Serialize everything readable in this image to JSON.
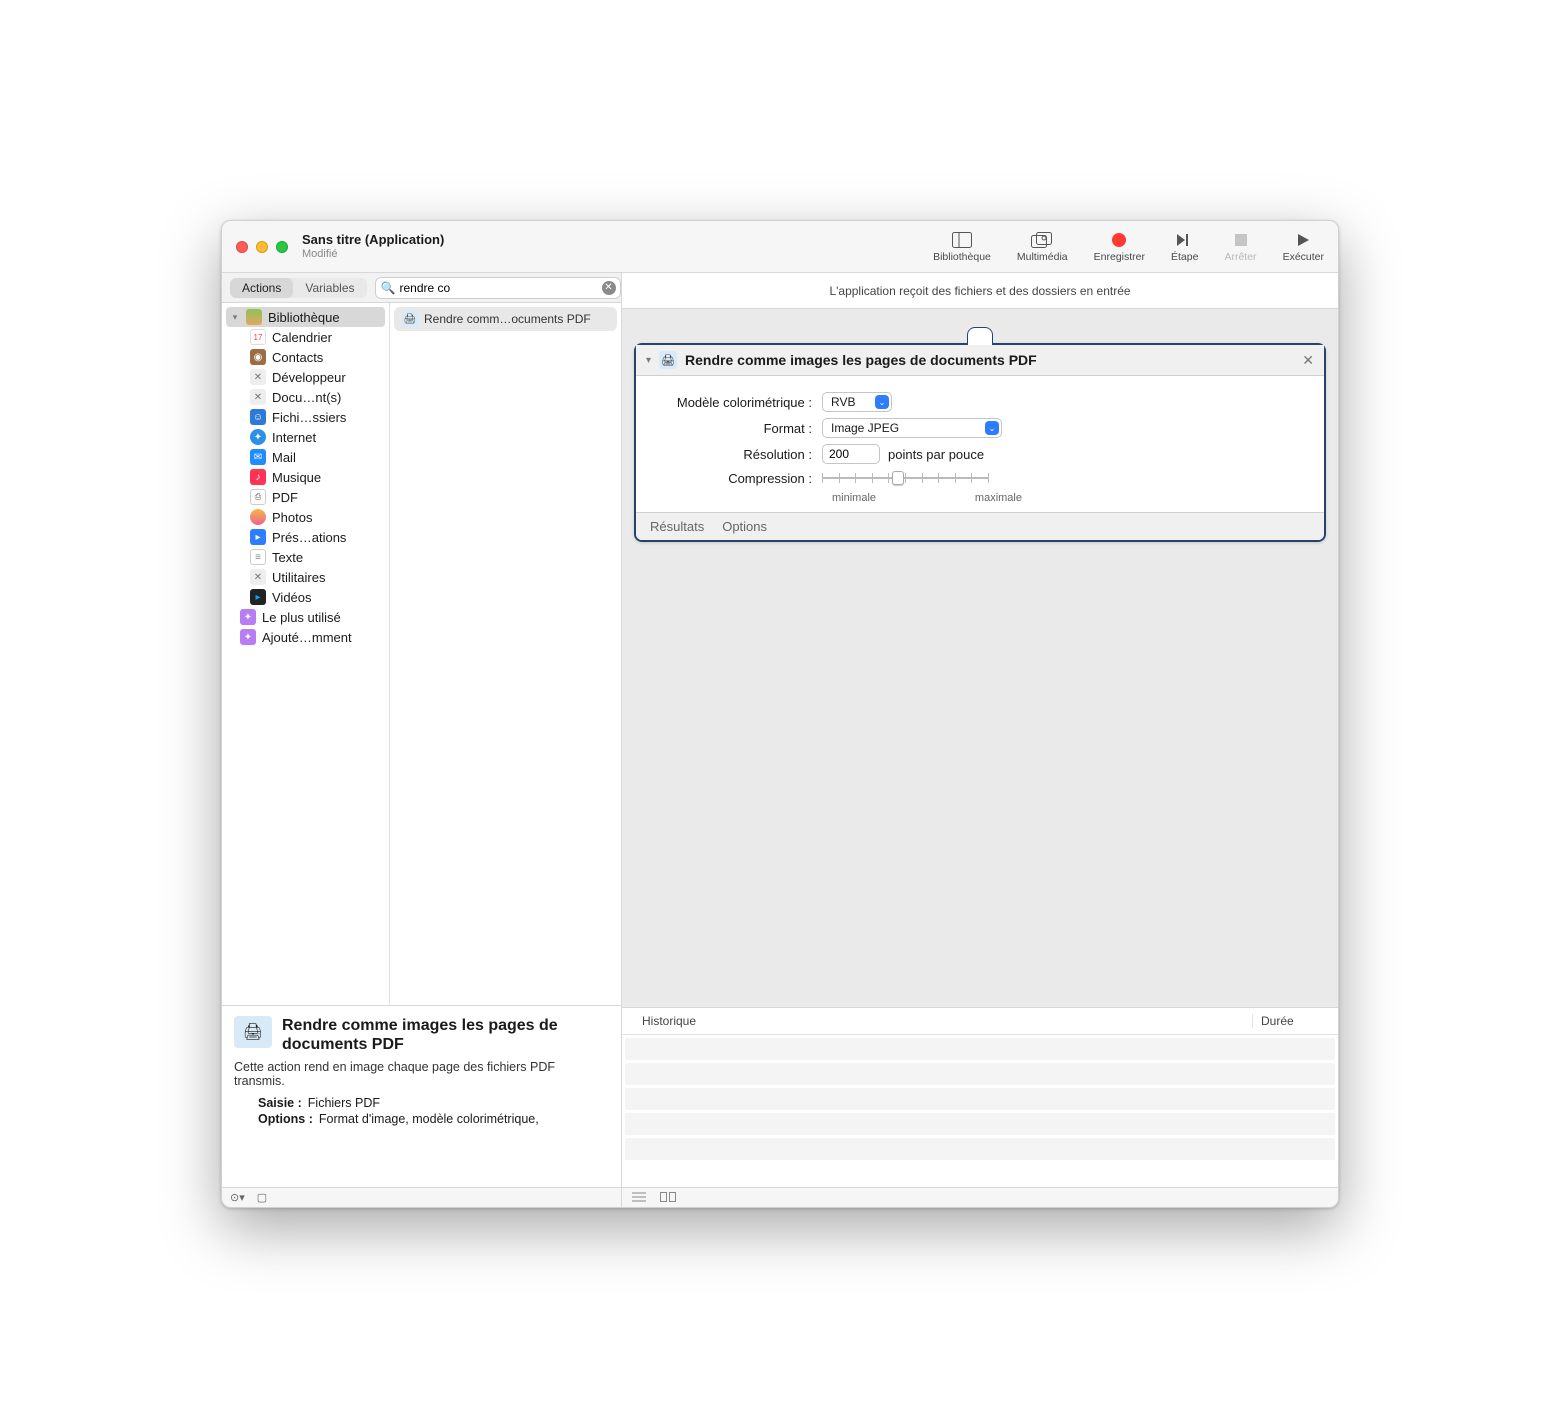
{
  "window": {
    "title": "Sans titre (Application)",
    "subtitle": "Modifié"
  },
  "toolbar": {
    "library": "Bibliothèque",
    "multimedia": "Multimédia",
    "record": "Enregistrer",
    "step": "Étape",
    "stop": "Arrêter",
    "run": "Exécuter"
  },
  "tabs": {
    "actions": "Actions",
    "variables": "Variables"
  },
  "search": {
    "value": "rendre co"
  },
  "library": {
    "header": "Bibliothèque",
    "items": [
      {
        "name": "Calendrier",
        "icon": "cal"
      },
      {
        "name": "Contacts",
        "icon": "contacts"
      },
      {
        "name": "Développeur",
        "icon": "dev"
      },
      {
        "name": "Docu…nt(s)",
        "icon": "doc"
      },
      {
        "name": "Fichi…ssiers",
        "icon": "files"
      },
      {
        "name": "Internet",
        "icon": "net"
      },
      {
        "name": "Mail",
        "icon": "mail"
      },
      {
        "name": "Musique",
        "icon": "music"
      },
      {
        "name": "PDF",
        "icon": "pdf"
      },
      {
        "name": "Photos",
        "icon": "photos"
      },
      {
        "name": "Prés…ations",
        "icon": "pres"
      },
      {
        "name": "Texte",
        "icon": "text"
      },
      {
        "name": "Utilitaires",
        "icon": "util"
      },
      {
        "name": "Vidéos",
        "icon": "video"
      }
    ],
    "smart": [
      {
        "name": "Le plus utilisé"
      },
      {
        "name": "Ajouté…mment"
      }
    ]
  },
  "results": {
    "row0": "Rendre comm…ocuments PDF"
  },
  "info": {
    "title": "Rendre comme images les pages de documents PDF",
    "desc": "Cette action rend en image chaque page des fichiers PDF transmis.",
    "input_label": "Saisie :",
    "input_value": "Fichiers PDF",
    "options_label": "Options :",
    "options_value": "Format d'image, modèle colorimétrique,"
  },
  "flow": {
    "intro": "L'application reçoit des fichiers et des dossiers en entrée"
  },
  "card": {
    "title": "Rendre comme images les pages de documents PDF",
    "labels": {
      "colormodel": "Modèle colorimétrique :",
      "format": "Format :",
      "resolution": "Résolution :",
      "compression": "Compression :"
    },
    "values": {
      "colormodel": "RVB",
      "format": "Image JPEG",
      "resolution": "200",
      "units": "points par pouce",
      "min": "minimale",
      "max": "maximale"
    },
    "footer": {
      "results": "Résultats",
      "options": "Options"
    }
  },
  "log": {
    "col_history": "Historique",
    "col_duration": "Durée"
  }
}
